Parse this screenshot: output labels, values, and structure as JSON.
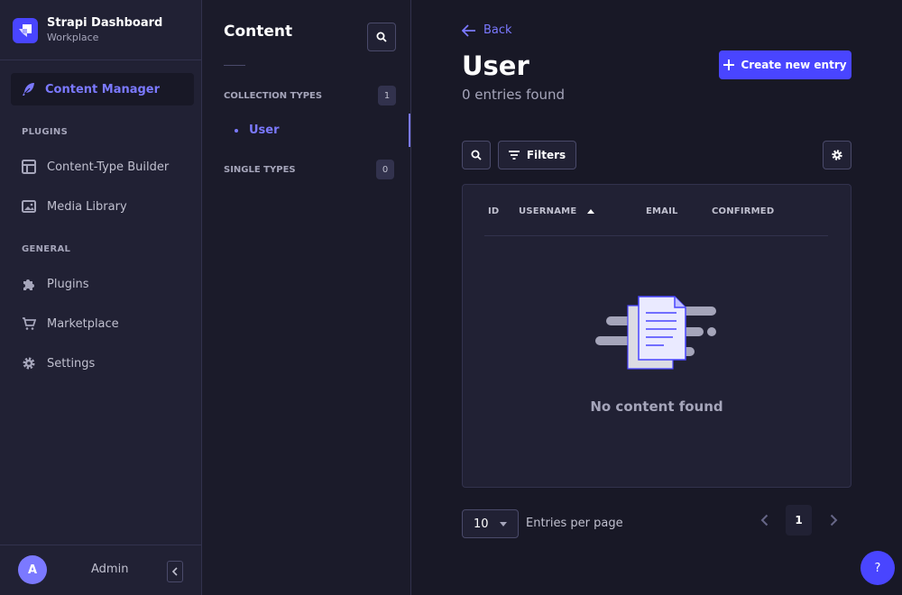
{
  "app": {
    "title": "Strapi Dashboard",
    "workspace": "Workplace"
  },
  "mainnav": {
    "active_item": "Content Manager",
    "sections": [
      {
        "title": "PLUGINS",
        "items": [
          "Content-Type Builder",
          "Media Library"
        ]
      },
      {
        "title": "GENERAL",
        "items": [
          "Plugins",
          "Marketplace",
          "Settings"
        ]
      }
    ],
    "user": {
      "initial": "A",
      "name": "Admin"
    }
  },
  "subnav": {
    "title": "Content",
    "collection_types": {
      "label": "COLLECTION TYPES",
      "count": "1",
      "items": [
        "User"
      ]
    },
    "single_types": {
      "label": "SINGLE TYPES",
      "count": "0"
    }
  },
  "main": {
    "back_label": "Back",
    "title": "User",
    "subtitle": "0 entries found",
    "create_label": "Create new entry",
    "filters_label": "Filters",
    "columns": [
      "ID",
      "USERNAME",
      "EMAIL",
      "CONFIRMED"
    ],
    "empty_text": "No content found",
    "per_page_value": "10",
    "per_page_label": "Entries per page",
    "current_page": "1",
    "help_label": "?"
  },
  "colors": {
    "accent": "#4945ff",
    "accent_text": "#7b79ff",
    "background": "#181826",
    "panel": "#212134"
  }
}
